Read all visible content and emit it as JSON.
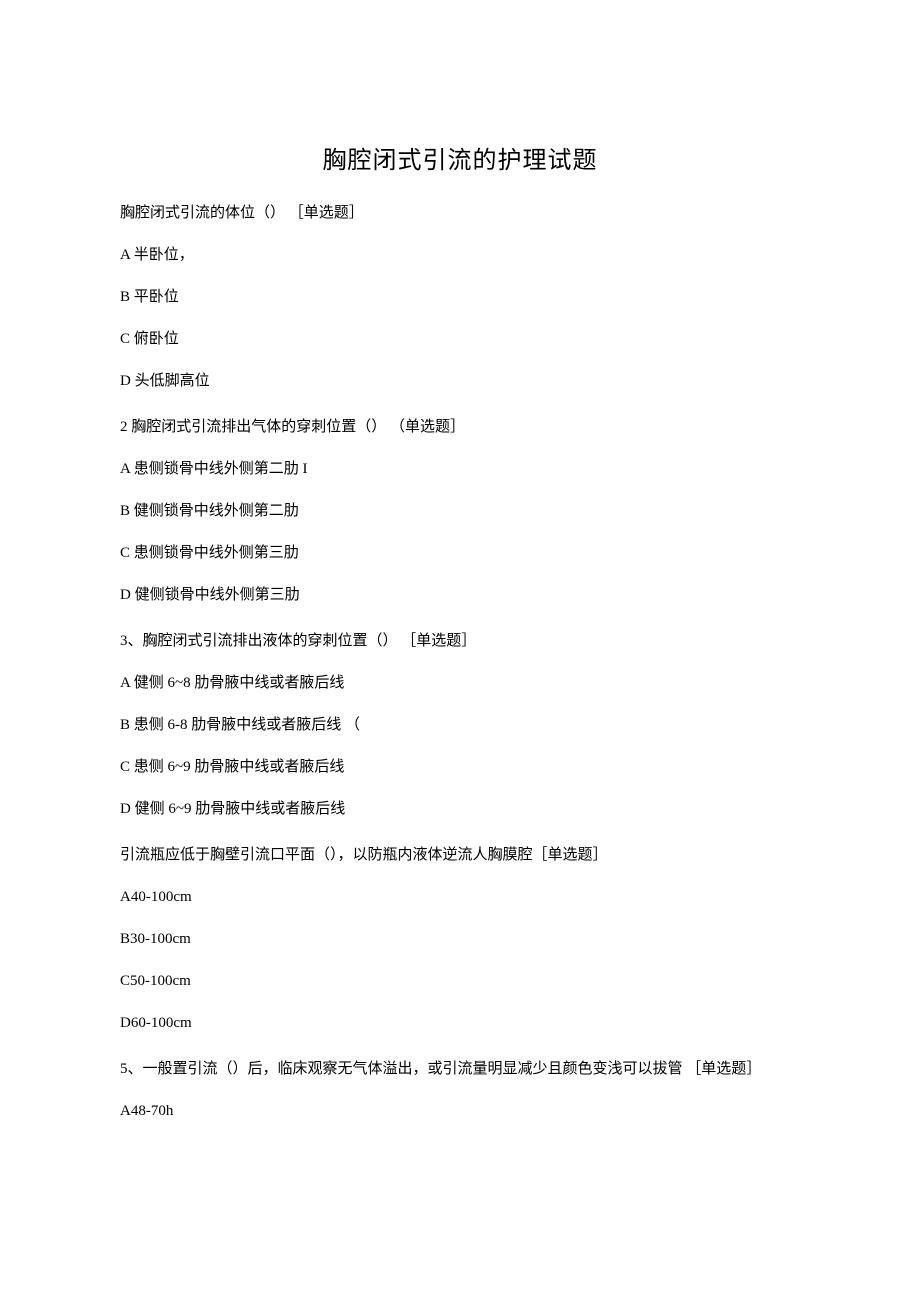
{
  "title": "胸腔闭式引流的护理试题",
  "questions": [
    {
      "stem": "胸腔闭式引流的体位（） ［单选题］",
      "options": [
        "A 半卧位，",
        "B 平卧位",
        "C 俯卧位",
        "D 头低脚高位"
      ],
      "mark": ""
    },
    {
      "stem": "2 胸腔闭式引流排出气体的穿刺位置（） （单选题］",
      "options": [
        "A 患侧锁骨中线外侧第二肋 I",
        "B 健侧锁骨中线外侧第二肋",
        "C 患侧锁骨中线外侧第三肋",
        "D 健侧锁骨中线外侧第三肋"
      ],
      "mark": ""
    },
    {
      "stem": "3、胸腔闭式引流排出液体的穿刺位置（） ［单选题］",
      "options": [
        "A 健侧 6~8 肋骨腋中线或者腋后线",
        "B 患侧 6-8 肋骨腋中线或者腋后线 （",
        "C 患侧 6~9 肋骨腋中线或者腋后线",
        "D 健侧 6~9 肋骨腋中线或者腋后线"
      ],
      "mark": ""
    },
    {
      "stem": "引流瓶应低于胸壁引流口平面（），以防瓶内液体逆流人胸膜腔［单选题］",
      "options": [
        "A40-100cm",
        "B30-100cm",
        "C50-100cm",
        "D60-100cm"
      ],
      "mark": ""
    },
    {
      "stem": "5、一般置引流（）后，临床观察无气体溢出，或引流量明显减少且颜色变浅可以拔管 ［单选题］",
      "options": [
        "A48-70h"
      ],
      "mark": ""
    }
  ]
}
